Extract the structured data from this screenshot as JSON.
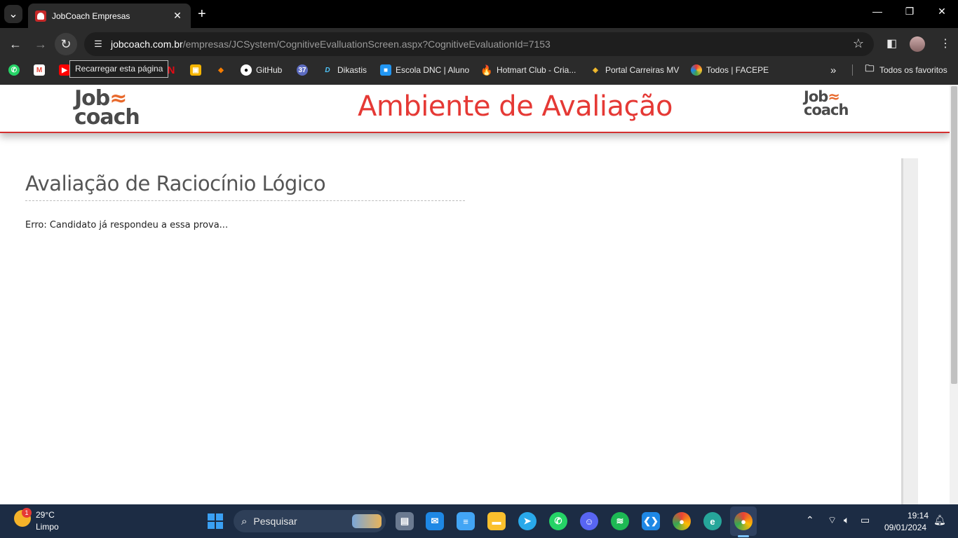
{
  "browser": {
    "tab_title": "JobCoach Empresas",
    "tab_close": "✕",
    "new_tab": "+",
    "url_host": "jobcoach.com.br",
    "url_path": "/empresas/JCSystem/CognitiveEvalluationScreen.aspx?CognitiveEvaluationId=7153",
    "tooltip": "Recarregar esta página",
    "bookmarks": [
      {
        "label": "",
        "icon": "whatsapp-icon",
        "color": "#25d366"
      },
      {
        "label": "",
        "icon": "gmail-icon",
        "color": "#ea4335"
      },
      {
        "label": "",
        "icon": "youtube-icon",
        "color": "#ff0000"
      },
      {
        "label": "",
        "icon": "netflix-icon",
        "color": "#e50914"
      },
      {
        "label": "",
        "icon": "classroom-icon",
        "color": "#f4b400"
      },
      {
        "label": "",
        "icon": "bookmark-icon",
        "color": "#f57c00"
      },
      {
        "label": "GitHub",
        "icon": "github-icon",
        "color": "#ffffff"
      },
      {
        "label": "",
        "icon": "calendar-icon",
        "color": "#5c6bc0"
      },
      {
        "label": "Dikastis",
        "icon": "dikastis-icon",
        "color": "#4fc3f7"
      },
      {
        "label": "Escola DNC | Aluno",
        "icon": "dnc-icon",
        "color": "#2196f3"
      },
      {
        "label": "Hotmart Club - Cria...",
        "icon": "hotmart-icon",
        "color": "#f4511e"
      },
      {
        "label": "Portal Carreiras MV",
        "icon": "mv-icon",
        "color": "#fbc02d"
      },
      {
        "label": "Todos | FACEPE",
        "icon": "facepe-icon",
        "color": "#43a047"
      }
    ],
    "all_bookmarks": "Todos os favoritos"
  },
  "page": {
    "logo_line1": "Job",
    "logo_wave": "≈",
    "logo_line2": "coach",
    "header_title": "Ambiente de Avaliação",
    "eval_title": "Avaliação de Raciocínio Lógico",
    "error_message": "Erro: Candidato já respondeu a essa prova...",
    "accent_color": "#e53935"
  },
  "taskbar": {
    "weather_badge": "1",
    "weather_temp": "29°C",
    "weather_desc": "Limpo",
    "search_placeholder": "Pesquisar",
    "apps": [
      {
        "name": "task-view-icon",
        "color": "#6b7a90"
      },
      {
        "name": "mail-icon",
        "color": "#1e88e5"
      },
      {
        "name": "notepad-icon",
        "color": "#42a5f5"
      },
      {
        "name": "file-explorer-icon",
        "color": "#fbc02d"
      },
      {
        "name": "telegram-icon",
        "color": "#29a9eb"
      },
      {
        "name": "whatsapp-icon",
        "color": "#25d366"
      },
      {
        "name": "discord-icon",
        "color": "#5865f2"
      },
      {
        "name": "spotify-icon",
        "color": "#1db954"
      },
      {
        "name": "vscode-icon",
        "color": "#1e88e5"
      },
      {
        "name": "chrome-icon",
        "color": "#fbbc04"
      },
      {
        "name": "edge-icon",
        "color": "#26a69a"
      },
      {
        "name": "chrome-profile-icon",
        "color": "#fbbc04"
      }
    ],
    "time": "19:14",
    "date": "09/01/2024"
  }
}
